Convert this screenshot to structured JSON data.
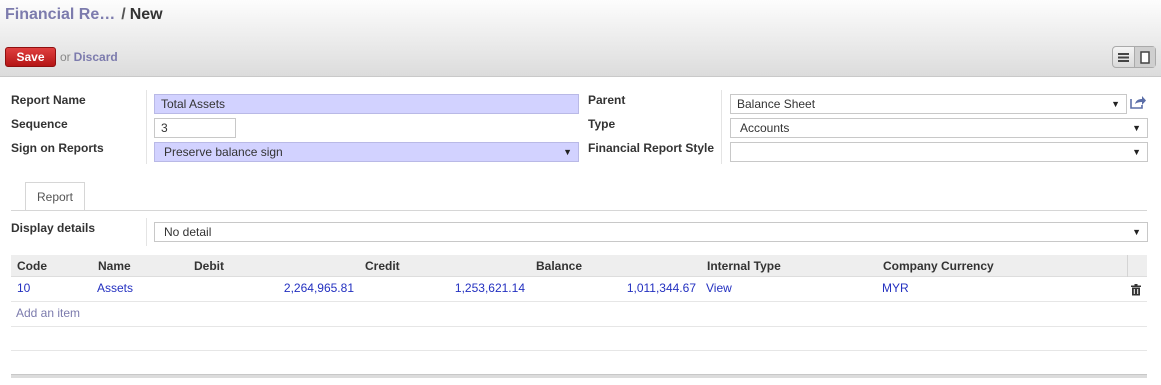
{
  "breadcrumb": {
    "parent": "Financial Re…",
    "separator": "/",
    "current": "New"
  },
  "toolbar": {
    "save_label": "Save",
    "or_label": "or",
    "discard_label": "Discard"
  },
  "view_switcher": {
    "list_icon": "list-icon",
    "form_icon": "form-icon",
    "active": "form"
  },
  "form": {
    "report_name": {
      "label": "Report Name",
      "value": "Total Assets"
    },
    "sequence": {
      "label": "Sequence",
      "value": "3"
    },
    "sign_on_reports": {
      "label": "Sign on Reports",
      "value": "Preserve balance sign"
    },
    "parent": {
      "label": "Parent",
      "value": "Balance Sheet"
    },
    "type": {
      "label": "Type",
      "value": "Accounts"
    },
    "style": {
      "label": "Financial Report Style",
      "value": ""
    }
  },
  "tabs": [
    {
      "label": "Report",
      "active": true
    }
  ],
  "display_details": {
    "label": "Display details",
    "value": "No detail"
  },
  "table": {
    "columns": [
      "Code",
      "Name",
      "Debit",
      "Credit",
      "Balance",
      "Internal Type",
      "Company Currency"
    ],
    "rows": [
      {
        "code": "10",
        "name": "Assets",
        "debit": "2,264,965.81",
        "credit": "1,253,621.14",
        "balance": "1,011,344.67",
        "internal_type": "View",
        "currency": "MYR"
      }
    ],
    "add_item_label": "Add an item"
  },
  "colors": {
    "required_field": "#d2d2ff",
    "link": "#7c7bad",
    "save_button": "#c92a2a",
    "row_text": "#2330c0"
  }
}
